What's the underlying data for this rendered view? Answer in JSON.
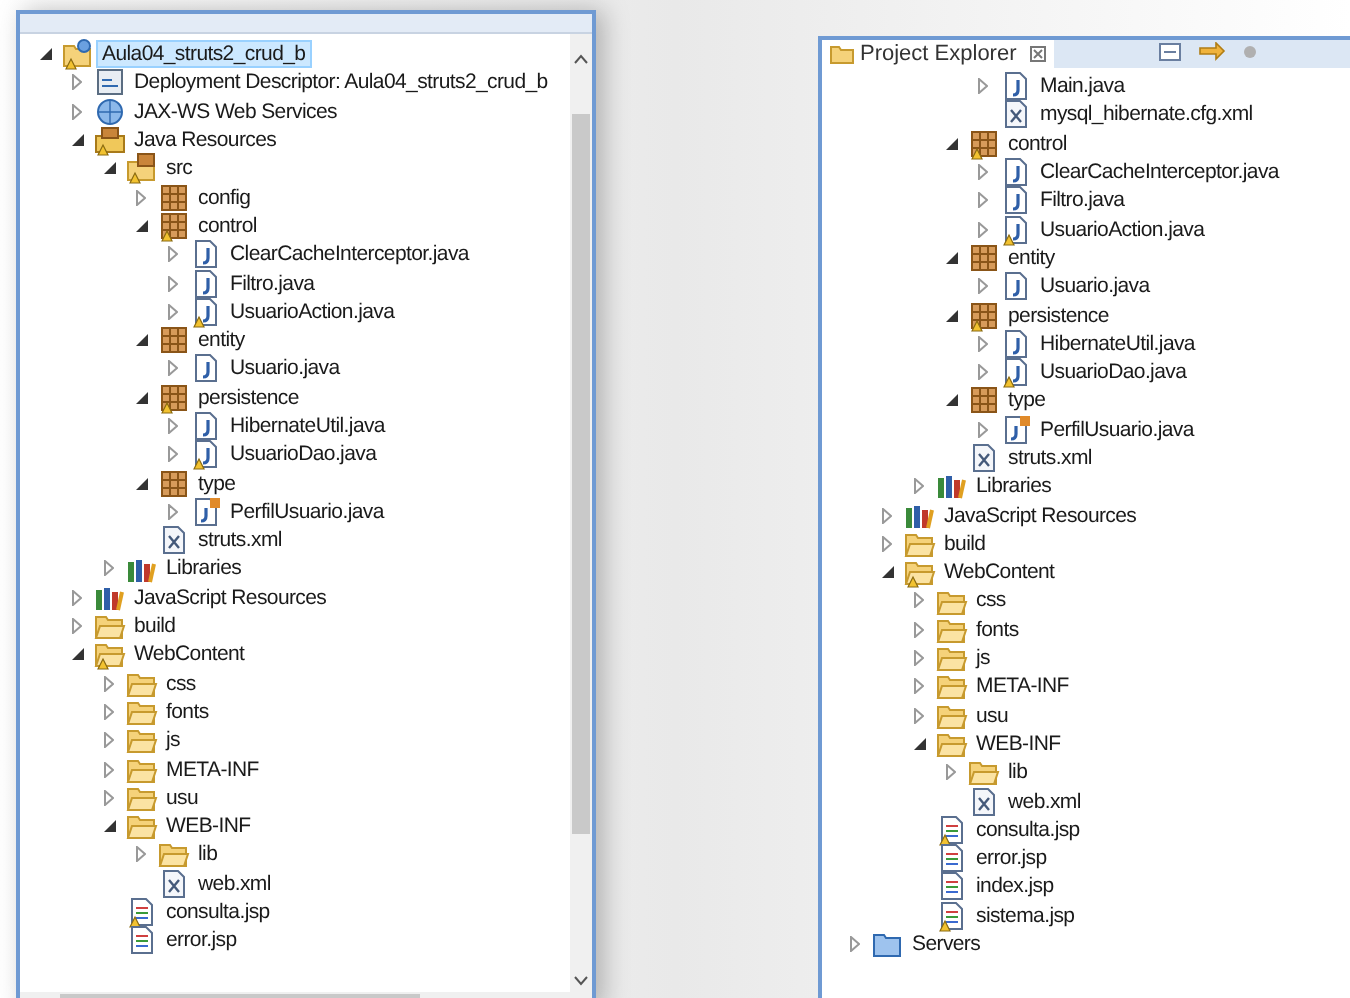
{
  "left_panel": {
    "tree": [
      {
        "label": "Aula04_struts2_crud_b",
        "kind": "project",
        "expanded": true,
        "selected": true,
        "warning": true,
        "children": [
          {
            "label": "Deployment Descriptor: Aula04_struts2_crud_b",
            "kind": "descriptor",
            "expanded": false,
            "selected": false,
            "warning": false
          },
          {
            "label": "JAX-WS Web Services",
            "kind": "webservices",
            "expanded": false,
            "selected": false,
            "warning": false
          },
          {
            "label": "Java Resources",
            "kind": "javares",
            "expanded": true,
            "selected": false,
            "warning": true,
            "children": [
              {
                "label": "src",
                "kind": "srcfolder",
                "expanded": true,
                "selected": false,
                "warning": true,
                "children": [
                  {
                    "label": "config",
                    "kind": "package",
                    "expanded": false,
                    "selected": false,
                    "warning": false
                  },
                  {
                    "label": "control",
                    "kind": "package",
                    "expanded": true,
                    "selected": false,
                    "warning": true,
                    "children": [
                      {
                        "label": "ClearCacheInterceptor.java",
                        "kind": "java",
                        "expanded": false,
                        "selected": false,
                        "warning": false
                      },
                      {
                        "label": "Filtro.java",
                        "kind": "java",
                        "expanded": false,
                        "selected": false,
                        "warning": false
                      },
                      {
                        "label": "UsuarioAction.java",
                        "kind": "java",
                        "expanded": false,
                        "selected": false,
                        "warning": true
                      }
                    ]
                  },
                  {
                    "label": "entity",
                    "kind": "package",
                    "expanded": true,
                    "selected": false,
                    "warning": false,
                    "children": [
                      {
                        "label": "Usuario.java",
                        "kind": "java",
                        "expanded": false,
                        "selected": false,
                        "warning": false
                      }
                    ]
                  },
                  {
                    "label": "persistence",
                    "kind": "package",
                    "expanded": true,
                    "selected": false,
                    "warning": true,
                    "children": [
                      {
                        "label": "HibernateUtil.java",
                        "kind": "java",
                        "expanded": false,
                        "selected": false,
                        "warning": false
                      },
                      {
                        "label": "UsuarioDao.java",
                        "kind": "java",
                        "expanded": false,
                        "selected": false,
                        "warning": true
                      }
                    ]
                  },
                  {
                    "label": "type",
                    "kind": "package",
                    "expanded": true,
                    "selected": false,
                    "warning": false,
                    "children": [
                      {
                        "label": "PerfilUsuario.java",
                        "kind": "enum",
                        "expanded": false,
                        "selected": false,
                        "warning": false
                      }
                    ]
                  },
                  {
                    "label": "struts.xml",
                    "kind": "xml",
                    "selected": false,
                    "warning": false
                  }
                ]
              },
              {
                "label": "Libraries",
                "kind": "libraries",
                "expanded": false,
                "selected": false,
                "warning": false
              }
            ]
          },
          {
            "label": "JavaScript Resources",
            "kind": "libraries",
            "expanded": false,
            "selected": false,
            "warning": false
          },
          {
            "label": "build",
            "kind": "folder",
            "expanded": false,
            "selected": false,
            "warning": false
          },
          {
            "label": "WebContent",
            "kind": "folder",
            "expanded": true,
            "selected": false,
            "warning": true,
            "children": [
              {
                "label": "css",
                "kind": "folder",
                "expanded": false,
                "selected": false,
                "warning": false
              },
              {
                "label": "fonts",
                "kind": "folder",
                "expanded": false,
                "selected": false,
                "warning": false
              },
              {
                "label": "js",
                "kind": "folder",
                "expanded": false,
                "selected": false,
                "warning": false
              },
              {
                "label": "META-INF",
                "kind": "folder",
                "expanded": false,
                "selected": false,
                "warning": false
              },
              {
                "label": "usu",
                "kind": "folder",
                "expanded": false,
                "selected": false,
                "warning": false
              },
              {
                "label": "WEB-INF",
                "kind": "folder",
                "expanded": true,
                "selected": false,
                "warning": false,
                "children": [
                  {
                    "label": "lib",
                    "kind": "folder",
                    "expanded": false,
                    "selected": false,
                    "warning": false
                  },
                  {
                    "label": "web.xml",
                    "kind": "xml",
                    "selected": false,
                    "warning": false
                  }
                ]
              },
              {
                "label": "consulta.jsp",
                "kind": "jsp",
                "selected": false,
                "warning": true
              },
              {
                "label": "error.jsp",
                "kind": "jsp",
                "selected": false,
                "warning": false
              }
            ]
          }
        ]
      }
    ]
  },
  "right_panel": {
    "tab": {
      "label": "Project Explorer",
      "selected": true
    },
    "tree": [
      {
        "children": [
          {
            "children": [
              {
                "children": [
                  {
                    "children": [
                      {
                        "label": "Main.java",
                        "kind": "java",
                        "expanded": false,
                        "selected": false,
                        "warning": false
                      },
                      {
                        "label": "mysql_hibernate.cfg.xml",
                        "kind": "xml",
                        "selected": false,
                        "warning": false
                      }
                    ]
                  },
                  {
                    "label": "control",
                    "kind": "package",
                    "expanded": true,
                    "selected": false,
                    "warning": true,
                    "children": [
                      {
                        "label": "ClearCacheInterceptor.java",
                        "kind": "java",
                        "expanded": false,
                        "selected": false,
                        "warning": false
                      },
                      {
                        "label": "Filtro.java",
                        "kind": "java",
                        "expanded": false,
                        "selected": false,
                        "warning": false
                      },
                      {
                        "label": "UsuarioAction.java",
                        "kind": "java",
                        "expanded": false,
                        "selected": false,
                        "warning": true
                      }
                    ]
                  },
                  {
                    "label": "entity",
                    "kind": "package",
                    "expanded": true,
                    "selected": false,
                    "warning": false,
                    "children": [
                      {
                        "label": "Usuario.java",
                        "kind": "java",
                        "expanded": false,
                        "selected": false,
                        "warning": false
                      }
                    ]
                  },
                  {
                    "label": "persistence",
                    "kind": "package",
                    "expanded": true,
                    "selected": false,
                    "warning": true,
                    "children": [
                      {
                        "label": "HibernateUtil.java",
                        "kind": "java",
                        "expanded": false,
                        "selected": false,
                        "warning": false
                      },
                      {
                        "label": "UsuarioDao.java",
                        "kind": "java",
                        "expanded": false,
                        "selected": false,
                        "warning": true
                      }
                    ]
                  },
                  {
                    "label": "type",
                    "kind": "package",
                    "expanded": true,
                    "selected": false,
                    "warning": false,
                    "children": [
                      {
                        "label": "PerfilUsuario.java",
                        "kind": "enum",
                        "expanded": false,
                        "selected": false,
                        "warning": false
                      }
                    ]
                  },
                  {
                    "label": "struts.xml",
                    "kind": "xml",
                    "selected": false,
                    "warning": false
                  }
                ]
              },
              {
                "label": "Libraries",
                "kind": "libraries",
                "expanded": false,
                "selected": false,
                "warning": false
              }
            ]
          },
          {
            "label": "JavaScript Resources",
            "kind": "libraries",
            "expanded": false,
            "selected": false,
            "warning": false
          },
          {
            "label": "build",
            "kind": "folder",
            "expanded": false,
            "selected": false,
            "warning": false
          },
          {
            "label": "WebContent",
            "kind": "folder",
            "expanded": true,
            "selected": false,
            "warning": true,
            "children": [
              {
                "label": "css",
                "kind": "folder",
                "expanded": false,
                "selected": false,
                "warning": false
              },
              {
                "label": "fonts",
                "kind": "folder",
                "expanded": false,
                "selected": false,
                "warning": false
              },
              {
                "label": "js",
                "kind": "folder",
                "expanded": false,
                "selected": false,
                "warning": false
              },
              {
                "label": "META-INF",
                "kind": "folder",
                "expanded": false,
                "selected": false,
                "warning": false
              },
              {
                "label": "usu",
                "kind": "folder",
                "expanded": false,
                "selected": false,
                "warning": false
              },
              {
                "label": "WEB-INF",
                "kind": "folder",
                "expanded": true,
                "selected": false,
                "warning": false,
                "children": [
                  {
                    "label": "lib",
                    "kind": "folder",
                    "expanded": false,
                    "selected": false,
                    "warning": false
                  },
                  {
                    "label": "web.xml",
                    "kind": "xml",
                    "selected": false,
                    "warning": false
                  }
                ]
              },
              {
                "label": "consulta.jsp",
                "kind": "jsp",
                "selected": false,
                "warning": true
              },
              {
                "label": "error.jsp",
                "kind": "jsp",
                "selected": false,
                "warning": false
              },
              {
                "label": "index.jsp",
                "kind": "jsp",
                "selected": false,
                "warning": false
              },
              {
                "label": "sistema.jsp",
                "kind": "jsp",
                "selected": false,
                "warning": true
              }
            ]
          }
        ]
      },
      {
        "label": "Servers",
        "kind": "servers",
        "expanded": false,
        "selected": false,
        "warning": false
      }
    ]
  }
}
